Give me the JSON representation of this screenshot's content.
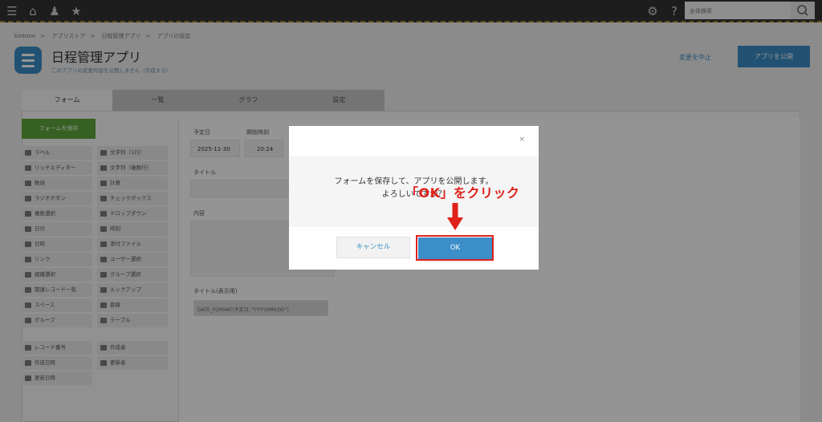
{
  "topbar": {
    "search_placeholder": "全体検索",
    "icons": [
      "menu-icon",
      "home-icon",
      "people-icon",
      "star-icon",
      "gear-icon",
      "help-icon",
      "search-icon"
    ]
  },
  "breadcrumb": [
    "kintone",
    "アプリストア",
    "日程管理アプリ",
    "アプリの設定"
  ],
  "app": {
    "title": "日程管理アプリ",
    "subtitle": "このアプリの変更内容を公開しません（作成する）",
    "cancel_link": "変更を中止",
    "publish_button": "アプリを公開"
  },
  "tabs": [
    "フォーム",
    "一覧",
    "グラフ",
    "設定"
  ],
  "form_editor": {
    "save_form_button": "フォームを保存",
    "palette": [
      "ラベル",
      "文字列（1行）",
      "リッチエディター",
      "文字列（複数行）",
      "数値",
      "計算",
      "ラジオボタン",
      "チェックボックス",
      "複数選択",
      "ドロップダウン",
      "日付",
      "時刻",
      "日時",
      "添付ファイル",
      "リンク",
      "ユーザー選択",
      "組織選択",
      "グループ選択",
      "関連レコード一覧",
      "ルックアップ",
      "スペース",
      "罫線",
      "グループ",
      "テーブル"
    ],
    "palette_system": [
      "レコード番号",
      "作成者",
      "作成日時",
      "更新者",
      "更新日時"
    ],
    "fields": {
      "date_label": "予定日",
      "date_value": "2025-11-30",
      "start_label": "開始時刻",
      "start_value": "20:24",
      "title_label": "タイトル",
      "content_label": "内容",
      "display_title_label": "タイトル(表示用)",
      "display_title_value": "DATE_FORMAT(予定日, \"YYYY/MM/DD\")"
    }
  },
  "dialog": {
    "message_line1": "フォームを保存して、アプリを公開します。",
    "message_line2": "よろしいですか？",
    "cancel_button": "キャンセル",
    "ok_button": "OK",
    "close_symbol": "×"
  },
  "annotation": {
    "text": "「OK」をクリック",
    "color": "#e0201a"
  },
  "colors": {
    "accent": "#3b8ec7",
    "save_green": "#5fa83c",
    "highlight": "#e0201a"
  }
}
